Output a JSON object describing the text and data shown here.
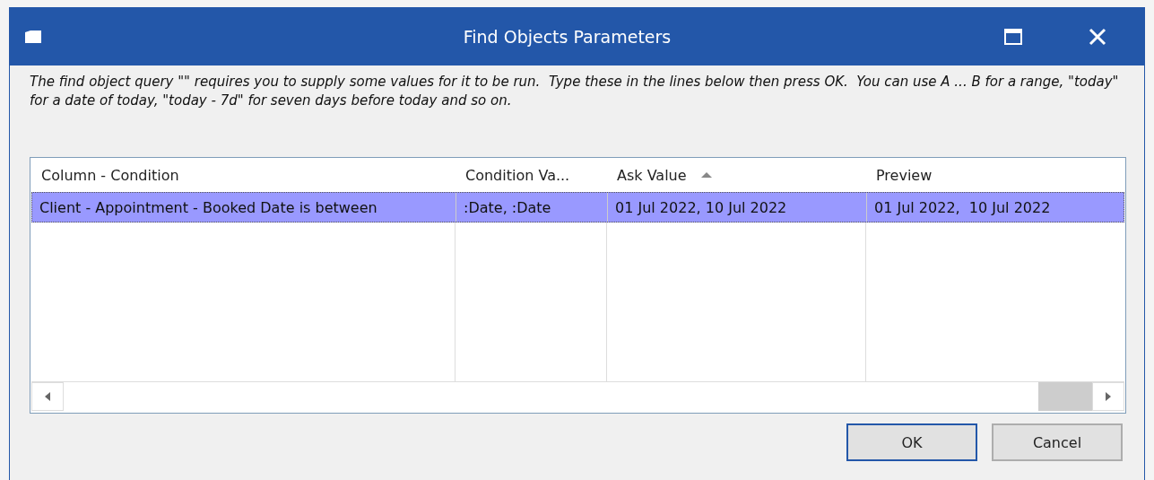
{
  "window": {
    "title": "Find Objects Parameters"
  },
  "instructions": "The find object query \"\" requires you to supply some values for it to be run.  Type these in the lines below then press OK.  You can use A ... B for a range, \"today\" for a date of today, \"today - 7d\" for seven days before today and so on.",
  "table": {
    "columns": [
      {
        "label": "Column - Condition"
      },
      {
        "label": "Condition Va..."
      },
      {
        "label": "Ask Value",
        "sorted": true
      },
      {
        "label": "Preview"
      }
    ],
    "rows": [
      {
        "cells": [
          "Client - Appointment - Booked Date is between",
          ":Date, :Date",
          "01 Jul 2022, 10 Jul 2022",
          "01 Jul 2022,  10 Jul 2022"
        ],
        "selected": true
      }
    ]
  },
  "buttons": [
    {
      "label": "OK",
      "default": true
    },
    {
      "label": "Cancel",
      "default": false
    }
  ]
}
